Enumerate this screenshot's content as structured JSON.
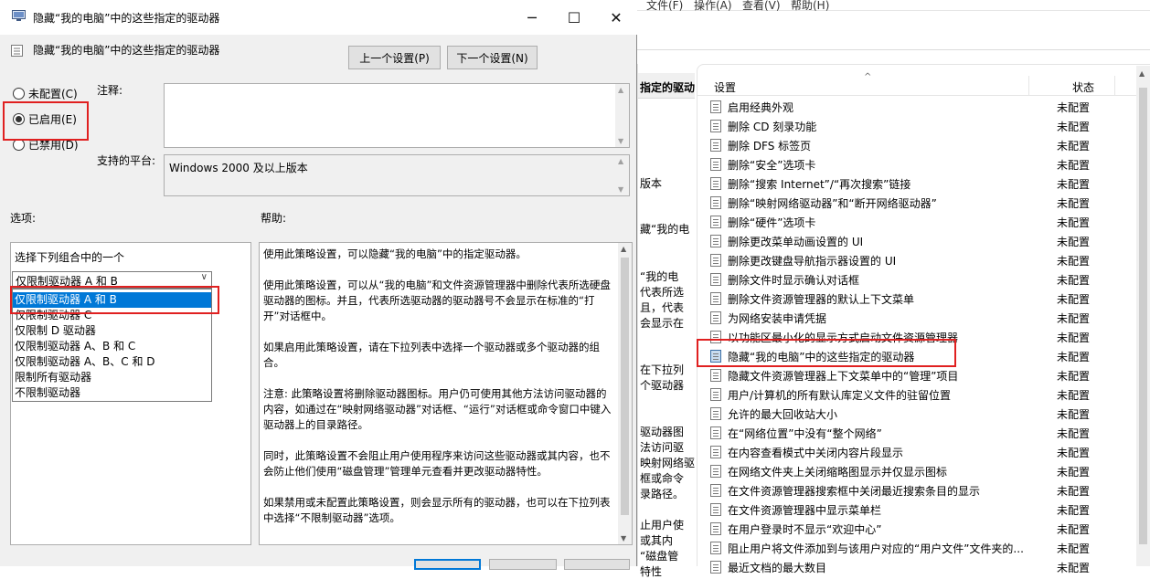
{
  "dialog": {
    "title": "隐藏“我的电脑”中的这些指定的驱动器",
    "header": "隐藏“我的电脑”中的这些指定的驱动器",
    "prev_button": "上一个设置(P)",
    "next_button": "下一个设置(N)",
    "radio_not_configured": "未配置(C)",
    "radio_enabled": "已启用(E)",
    "radio_disabled": "已禁用(D)",
    "selected_radio": "enabled",
    "comment_label": "注释:",
    "platform_label": "支持的平台:",
    "platform_value": "Windows 2000 及以上版本",
    "options_label": "选项:",
    "help_label": "帮助:",
    "options_prompt": "选择下列组合中的一个",
    "combo_value": "仅限制驱动器 A 和 B",
    "dropdown_options": [
      "仅限制驱动器 A 和 B",
      "仅限制驱动器 C",
      "仅限制 D 驱动器",
      "仅限制驱动器 A、B 和 C",
      "仅限制驱动器 A、B、C 和 D",
      "限制所有驱动器",
      "不限制驱动器"
    ],
    "dropdown_selected_index": 0,
    "help_paragraphs": [
      "使用此策略设置，可以隐藏“我的电脑”中的指定驱动器。",
      "使用此策略设置，可以从“我的电脑”和文件资源管理器中删除代表所选硬盘驱动器的图标。并且，代表所选驱动器的驱动器号不会显示在标准的“打开”对话框中。",
      "如果启用此策略设置，请在下拉列表中选择一个驱动器或多个驱动器的组合。",
      "注意: 此策略设置将删除驱动器图标。用户仍可使用其他方法访问驱动器的内容，如通过在“映射网络驱动器”对话框、“运行”对话框或命令窗口中键入驱动器上的目录路径。",
      "同时，此策略设置不会阻止用户使用程序来访问这些驱动器或其内容，也不会防止他们使用“磁盘管理”管理单元查看并更改驱动器特性。",
      "如果禁用或未配置此策略设置，则会显示所有的驱动器，也可以在下拉列表中选择“不限制驱动器”选项。"
    ]
  },
  "background": {
    "menubar": [
      "文件(F)",
      "操作(A)",
      "查看(V)",
      "帮助(H)"
    ],
    "desc_title": "指定的驱动",
    "desc_fragments": [
      "版本",
      "藏“我的电",
      "“我的电",
      "代表所选",
      "且，代表",
      "会显示在",
      "在下拉列",
      "个驱动器",
      "驱动器图",
      "法访问驱",
      "映射网络驱",
      "框或命令",
      "录路径。",
      "止用户使",
      "或其内",
      "“磁盘管",
      "特性"
    ],
    "column_setting": "设置",
    "column_state": "状态",
    "rows": [
      {
        "name": "启用经典外观",
        "state": "未配置"
      },
      {
        "name": "删除 CD 刻录功能",
        "state": "未配置"
      },
      {
        "name": "删除 DFS 标签页",
        "state": "未配置"
      },
      {
        "name": "删除“安全”选项卡",
        "state": "未配置"
      },
      {
        "name": "删除“搜索 Internet”/“再次搜索”链接",
        "state": "未配置"
      },
      {
        "name": "删除“映射网络驱动器”和“断开网络驱动器”",
        "state": "未配置"
      },
      {
        "name": "删除“硬件”选项卡",
        "state": "未配置"
      },
      {
        "name": "删除更改菜单动画设置的 UI",
        "state": "未配置"
      },
      {
        "name": "删除更改键盘导航指示器设置的 UI",
        "state": "未配置"
      },
      {
        "name": "删除文件时显示确认对话框",
        "state": "未配置"
      },
      {
        "name": "删除文件资源管理器的默认上下文菜单",
        "state": "未配置"
      },
      {
        "name": "为网络安装申请凭据",
        "state": "未配置"
      },
      {
        "name": "以功能区最小化的显示方式启动文件资源管理器",
        "state": "未配置"
      },
      {
        "name": "隐藏“我的电脑”中的这些指定的驱动器",
        "state": "未配置"
      },
      {
        "name": "隐藏文件资源管理器上下文菜单中的“管理”项目",
        "state": "未配置"
      },
      {
        "name": "用户/计算机的所有默认库定义文件的驻留位置",
        "state": "未配置"
      },
      {
        "name": "允许的最大回收站大小",
        "state": "未配置"
      },
      {
        "name": "在“网络位置”中没有“整个网络”",
        "state": "未配置"
      },
      {
        "name": "在内容查看模式中关闭内容片段显示",
        "state": "未配置"
      },
      {
        "name": "在网络文件夹上关闭缩略图显示并仅显示图标",
        "state": "未配置"
      },
      {
        "name": "在文件资源管理器搜索框中关闭最近搜索条目的显示",
        "state": "未配置"
      },
      {
        "name": "在文件资源管理器中显示菜单栏",
        "state": "未配置"
      },
      {
        "name": "在用户登录时不显示“欢迎中心”",
        "state": "未配置"
      },
      {
        "name": "阻止用户将文件添加到与该用户对应的“用户文件”文件夹的...",
        "state": "未配置"
      },
      {
        "name": "最近文档的最大数目",
        "state": "未配置"
      }
    ],
    "selected_row_index": 13
  },
  "colors": {
    "highlight_box": "#e02020",
    "selection_blue": "#0078d7",
    "dialog_bg": "#f0f0f0"
  }
}
